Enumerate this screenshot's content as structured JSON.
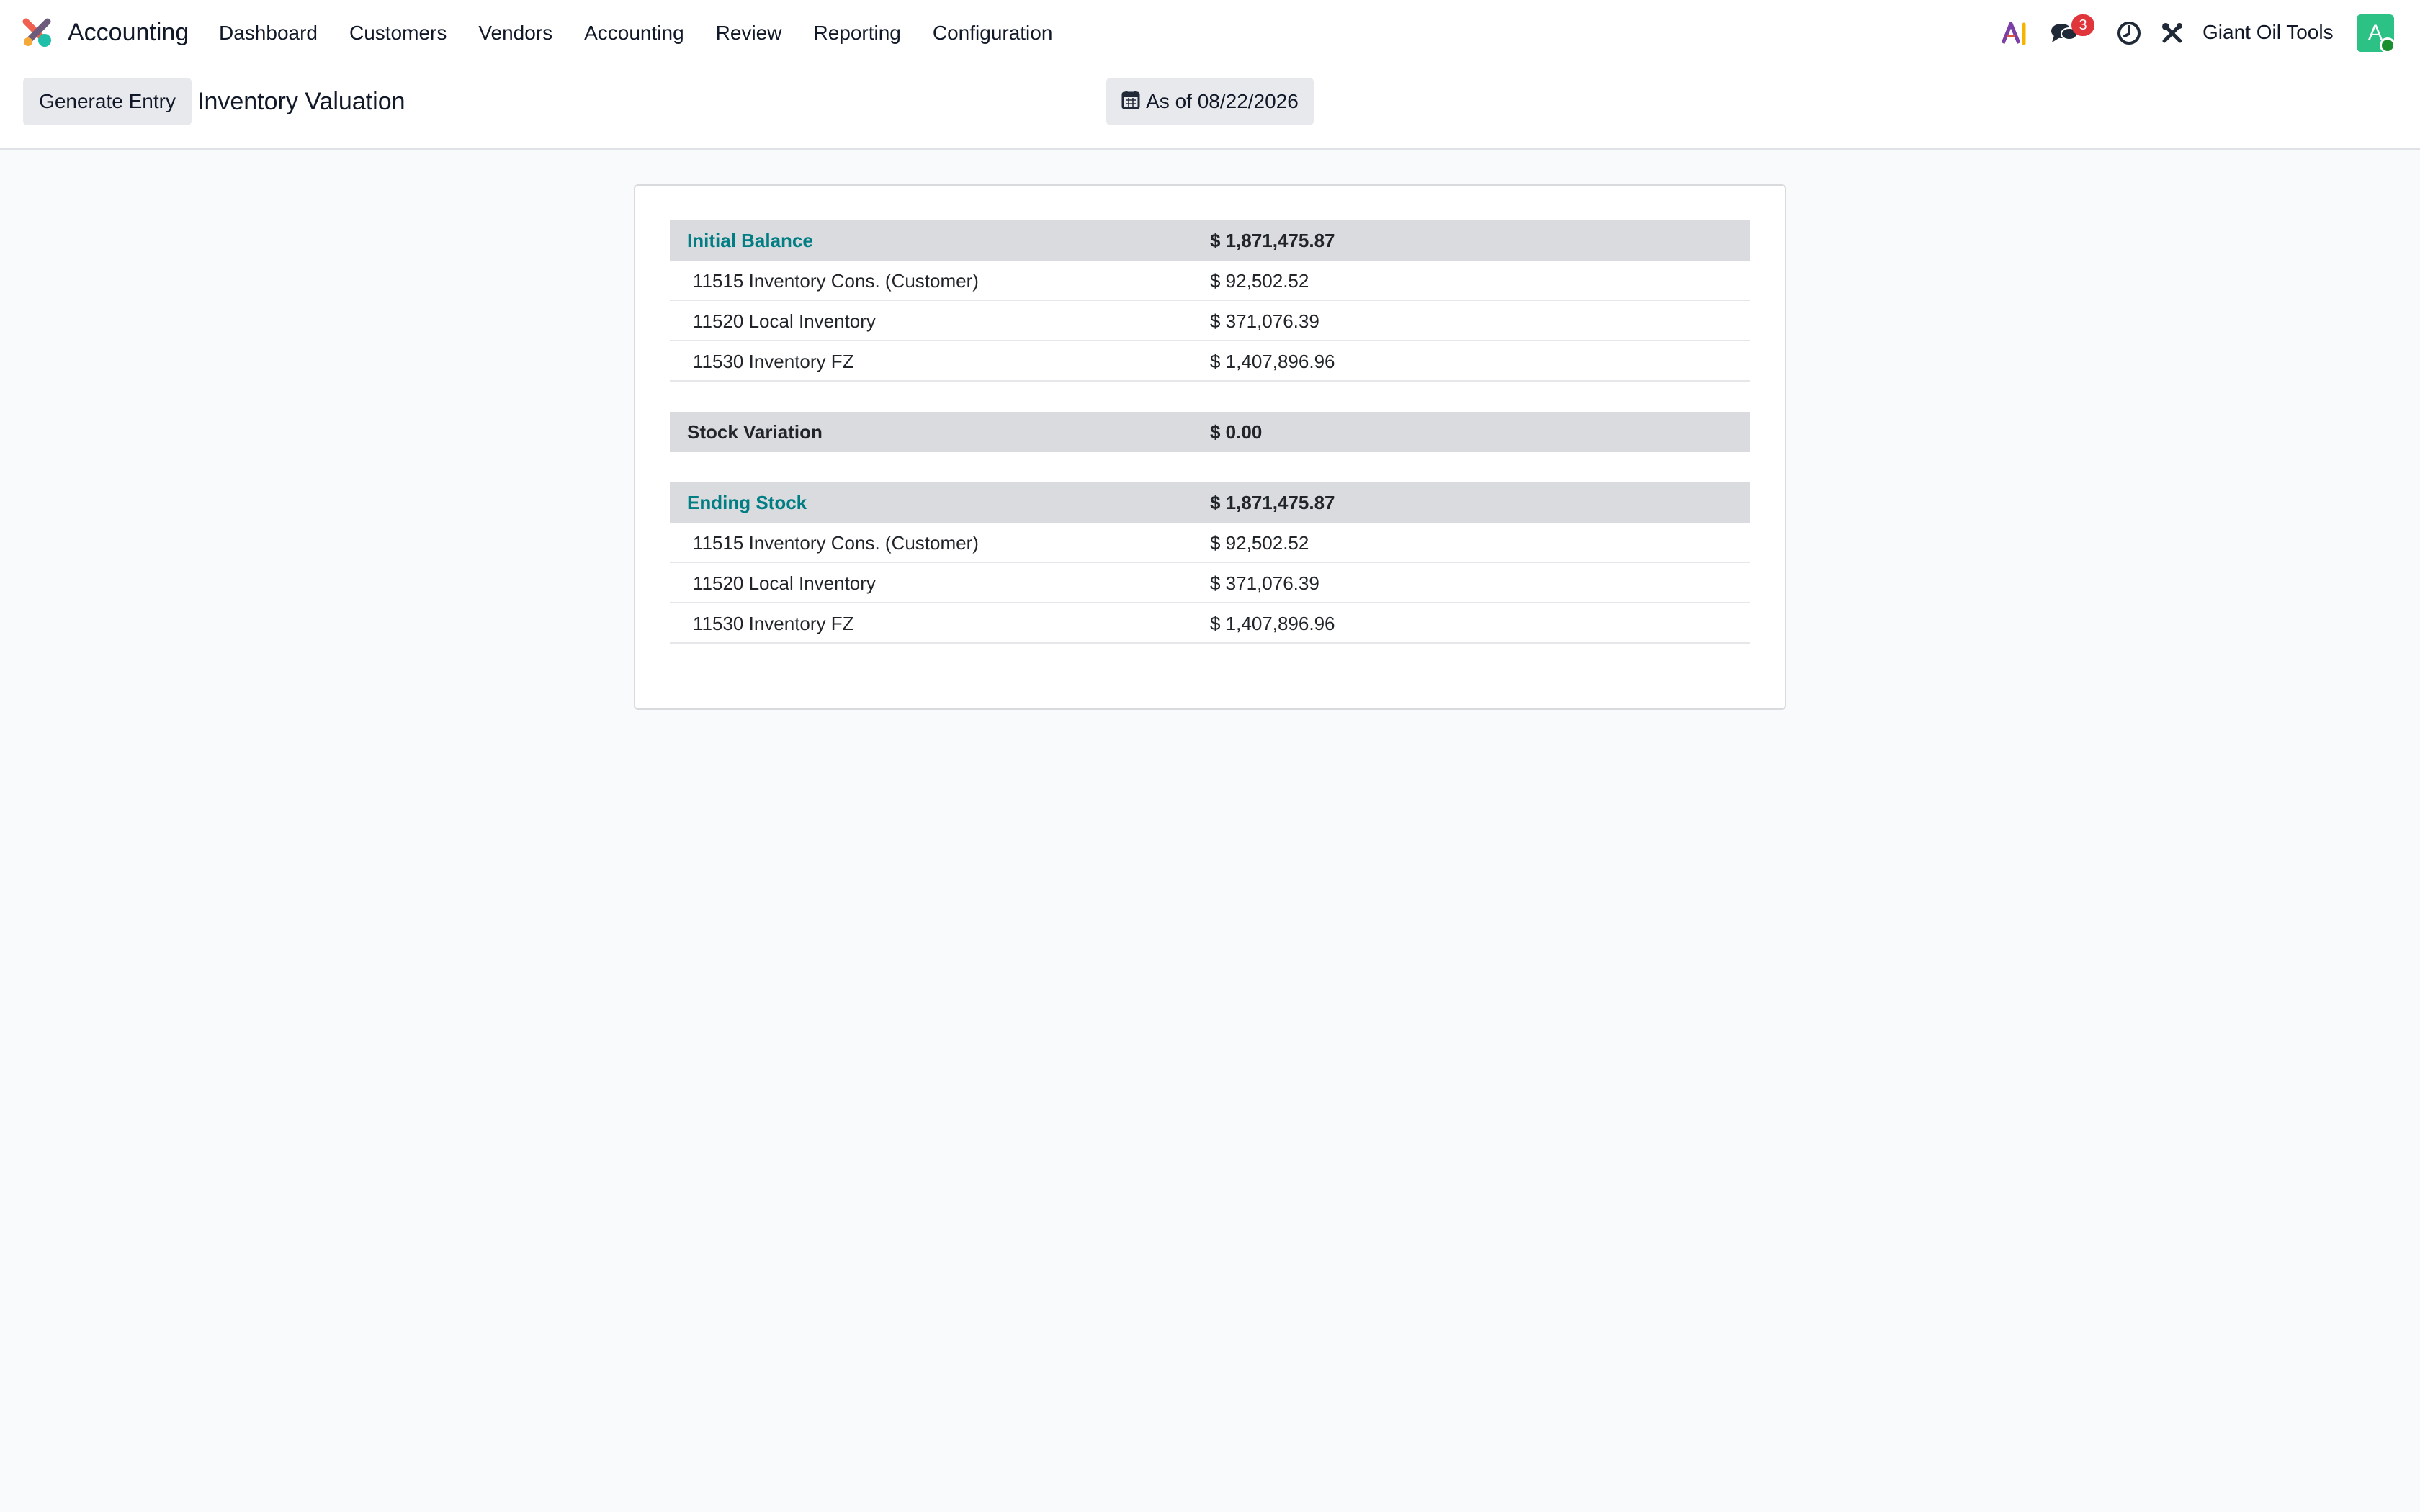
{
  "navbar": {
    "app_name": "Accounting",
    "menu": [
      "Dashboard",
      "Customers",
      "Vendors",
      "Accounting",
      "Review",
      "Reporting",
      "Configuration"
    ],
    "ai_icon_text": "AI",
    "messages_count": "3",
    "company": "Giant Oil Tools",
    "avatar_initial": "A"
  },
  "control_panel": {
    "generate_button": "Generate Entry",
    "title": "Inventory Valuation",
    "date_filter": "As of 08/22/2026"
  },
  "report": {
    "initial_balance": {
      "label": "Initial Balance",
      "total": "$ 1,871,475.87",
      "lines": [
        {
          "account": "11515 Inventory Cons. (Customer)",
          "amount": "$ 92,502.52"
        },
        {
          "account": "11520 Local Inventory",
          "amount": "$ 371,076.39"
        },
        {
          "account": "11530 Inventory FZ",
          "amount": "$ 1,407,896.96"
        }
      ]
    },
    "stock_variation": {
      "label": "Stock Variation",
      "total": "$ 0.00"
    },
    "ending_stock": {
      "label": "Ending Stock",
      "total": "$ 1,871,475.87",
      "lines": [
        {
          "account": "11515 Inventory Cons. (Customer)",
          "amount": "$ 92,502.52"
        },
        {
          "account": "11520 Local Inventory",
          "amount": "$ 371,076.39"
        },
        {
          "account": "11530 Inventory FZ",
          "amount": "$ 1,407,896.96"
        }
      ]
    }
  },
  "colors": {
    "accent_teal": "#017e84",
    "badge_red": "#e0353b",
    "avatar_green": "#2cc185",
    "section_header_bg": "#d9dbde"
  },
  "icons": [
    "accounting-app-logo-icon",
    "ai-icon",
    "chat-icon",
    "clock-icon",
    "tools-icon",
    "calendar-icon"
  ]
}
